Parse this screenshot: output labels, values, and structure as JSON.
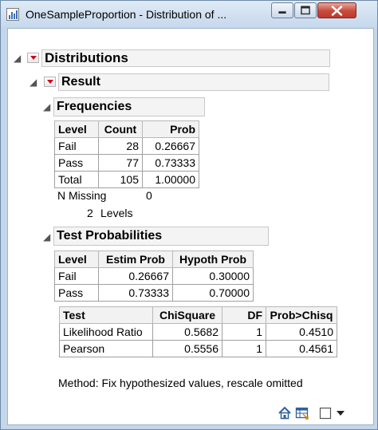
{
  "window": {
    "title": "OneSampleProportion - Distribution of ..."
  },
  "outline": {
    "distributions_title": "Distributions",
    "result_title": "Result",
    "frequencies": {
      "title": "Frequencies",
      "headers": [
        "Level",
        "Count",
        "Prob"
      ],
      "rows": [
        [
          "Fail",
          "28",
          "0.26667"
        ],
        [
          "Pass",
          "77",
          "0.73333"
        ],
        [
          "Total",
          "105",
          "1.00000"
        ]
      ],
      "n_missing_label": "N Missing",
      "n_missing_value": "0",
      "levels_count": "2",
      "levels_label": "Levels"
    },
    "test_probabilities": {
      "title": "Test Probabilities",
      "headers": [
        "Level",
        "Estim Prob",
        "Hypoth Prob"
      ],
      "rows": [
        [
          "Fail",
          "0.26667",
          "0.30000"
        ],
        [
          "Pass",
          "0.73333",
          "0.70000"
        ]
      ],
      "tests": {
        "headers": [
          "Test",
          "ChiSquare",
          "DF",
          "Prob>Chisq"
        ],
        "rows": [
          [
            "Likelihood Ratio",
            "0.5682",
            "1",
            "0.4510"
          ],
          [
            "Pearson",
            "0.5556",
            "1",
            "0.4561"
          ]
        ]
      },
      "method_note": "Method: Fix hypothesized values, rescale omitted"
    }
  },
  "statusbar": {
    "icons": [
      "home-icon",
      "table-view-icon",
      "checkbox-icon",
      "dropdown-arrow-icon"
    ]
  },
  "colors": {
    "disclosure_red": "#d0021b",
    "window_frame": "#c4d6ea",
    "close_button": "#c7493a"
  }
}
